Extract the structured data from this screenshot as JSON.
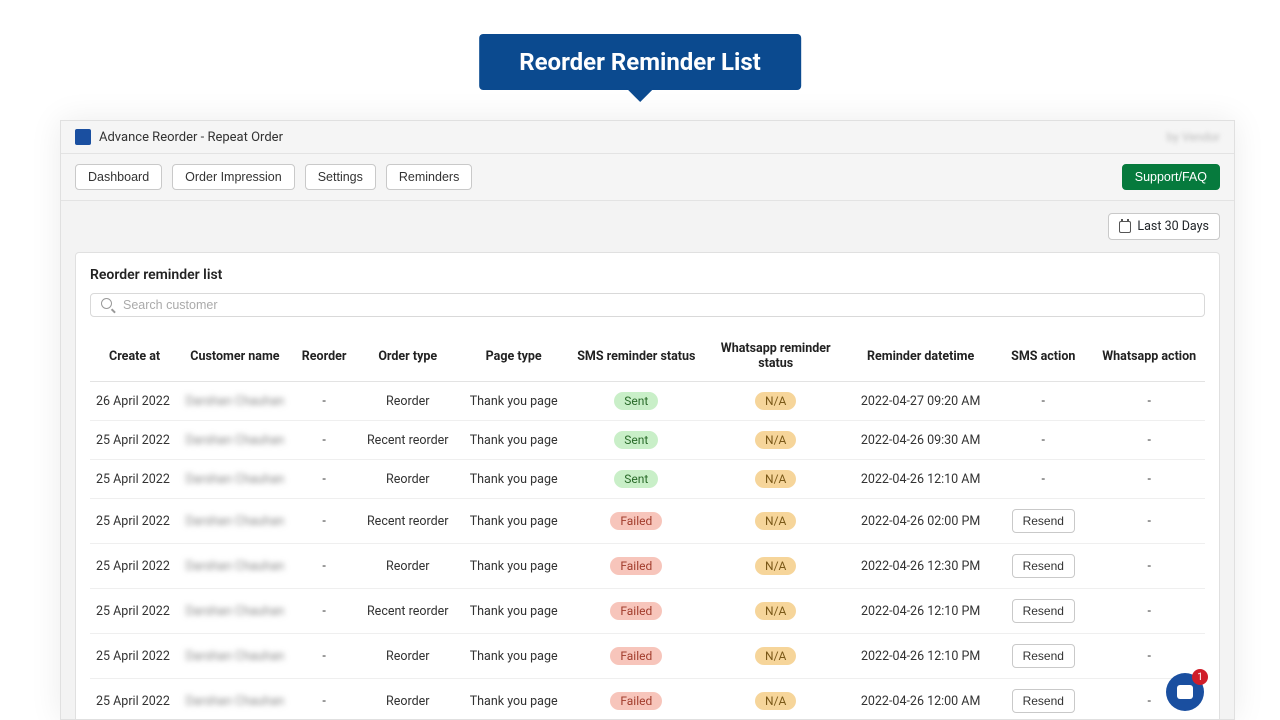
{
  "callout": "Reorder Reminder List",
  "header": {
    "app_title": "Advance Reorder - Repeat Order",
    "by": "by Vendor"
  },
  "toolbar": {
    "nav": [
      "Dashboard",
      "Order Impression",
      "Settings",
      "Reminders"
    ],
    "support": "Support/FAQ"
  },
  "filter": {
    "date_range": "Last 30 Days"
  },
  "panel": {
    "title": "Reorder reminder list",
    "search_placeholder": "Search customer"
  },
  "table": {
    "columns": [
      "Create at",
      "Customer name",
      "Reorder",
      "Order type",
      "Page type",
      "SMS reminder status",
      "Whatsapp reminder status",
      "Reminder datetime",
      "SMS action",
      "Whatsapp action"
    ],
    "rows": [
      {
        "create_at": "26 April 2022",
        "customer": "Darshan Chauhan",
        "reorder": "-",
        "order_type": "Reorder",
        "page_type": "Thank you page",
        "sms_status": "Sent",
        "wa_status": "N/A",
        "datetime": "2022-04-27 09:20 AM",
        "sms_action": "-",
        "wa_action": "-"
      },
      {
        "create_at": "25 April 2022",
        "customer": "Darshan Chauhan",
        "reorder": "-",
        "order_type": "Recent reorder",
        "page_type": "Thank you page",
        "sms_status": "Sent",
        "wa_status": "N/A",
        "datetime": "2022-04-26 09:30 AM",
        "sms_action": "-",
        "wa_action": "-"
      },
      {
        "create_at": "25 April 2022",
        "customer": "Darshan Chauhan",
        "reorder": "-",
        "order_type": "Reorder",
        "page_type": "Thank you page",
        "sms_status": "Sent",
        "wa_status": "N/A",
        "datetime": "2022-04-26 12:10 AM",
        "sms_action": "-",
        "wa_action": "-"
      },
      {
        "create_at": "25 April 2022",
        "customer": "Darshan Chauhan",
        "reorder": "-",
        "order_type": "Recent reorder",
        "page_type": "Thank you page",
        "sms_status": "Failed",
        "wa_status": "N/A",
        "datetime": "2022-04-26 02:00 PM",
        "sms_action": "Resend",
        "wa_action": "-"
      },
      {
        "create_at": "25 April 2022",
        "customer": "Darshan Chauhan",
        "reorder": "-",
        "order_type": "Reorder",
        "page_type": "Thank you page",
        "sms_status": "Failed",
        "wa_status": "N/A",
        "datetime": "2022-04-26 12:30 PM",
        "sms_action": "Resend",
        "wa_action": "-"
      },
      {
        "create_at": "25 April 2022",
        "customer": "Darshan Chauhan",
        "reorder": "-",
        "order_type": "Recent reorder",
        "page_type": "Thank you page",
        "sms_status": "Failed",
        "wa_status": "N/A",
        "datetime": "2022-04-26 12:10 PM",
        "sms_action": "Resend",
        "wa_action": "-"
      },
      {
        "create_at": "25 April 2022",
        "customer": "Darshan Chauhan",
        "reorder": "-",
        "order_type": "Reorder",
        "page_type": "Thank you page",
        "sms_status": "Failed",
        "wa_status": "N/A",
        "datetime": "2022-04-26 12:10 PM",
        "sms_action": "Resend",
        "wa_action": "-"
      },
      {
        "create_at": "25 April 2022",
        "customer": "Darshan Chauhan",
        "reorder": "-",
        "order_type": "Reorder",
        "page_type": "Thank you page",
        "sms_status": "Failed",
        "wa_status": "N/A",
        "datetime": "2022-04-26 12:00 AM",
        "sms_action": "Resend",
        "wa_action": "-"
      }
    ]
  },
  "resend_label": "Resend",
  "chat_badge": "1"
}
